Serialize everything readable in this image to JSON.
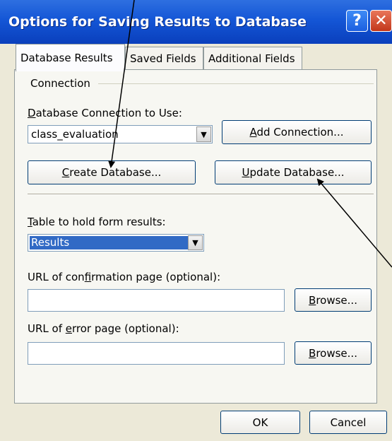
{
  "window": {
    "title": "Options for Saving Results to Database",
    "help_glyph": "?",
    "close_glyph": "✕"
  },
  "tabs": [
    {
      "label": "Database Results"
    },
    {
      "label": "Saved Fields"
    },
    {
      "label": "Additional Fields"
    }
  ],
  "connection": {
    "group_label": "Connection",
    "db_label_pre": "",
    "db_label_key": "D",
    "db_label_post": "atabase Connection to Use:",
    "db_value": "class_evaluation",
    "add_pre": "",
    "add_key": "A",
    "add_post": "dd Connection...",
    "create_pre": "",
    "create_key": "C",
    "create_post": "reate Database...",
    "update_pre": "",
    "update_key": "U",
    "update_post": "pdate Database..."
  },
  "table": {
    "label_pre": "",
    "label_key": "T",
    "label_post": "able to hold form results:",
    "value": "Results"
  },
  "confirm": {
    "label_pre": "URL of con",
    "label_key": "f",
    "label_post": "irmation page (optional):",
    "value": "",
    "browse_pre": "",
    "browse_key": "B",
    "browse_post": "rowse..."
  },
  "error": {
    "label_pre": "URL of ",
    "label_key": "e",
    "label_post": "rror page (optional):",
    "value": "",
    "browse_pre": "",
    "browse_key": "B",
    "browse_post": "rowse..."
  },
  "footer": {
    "ok": "OK",
    "cancel": "Cancel"
  },
  "icons": {
    "dropdown": "▼"
  }
}
